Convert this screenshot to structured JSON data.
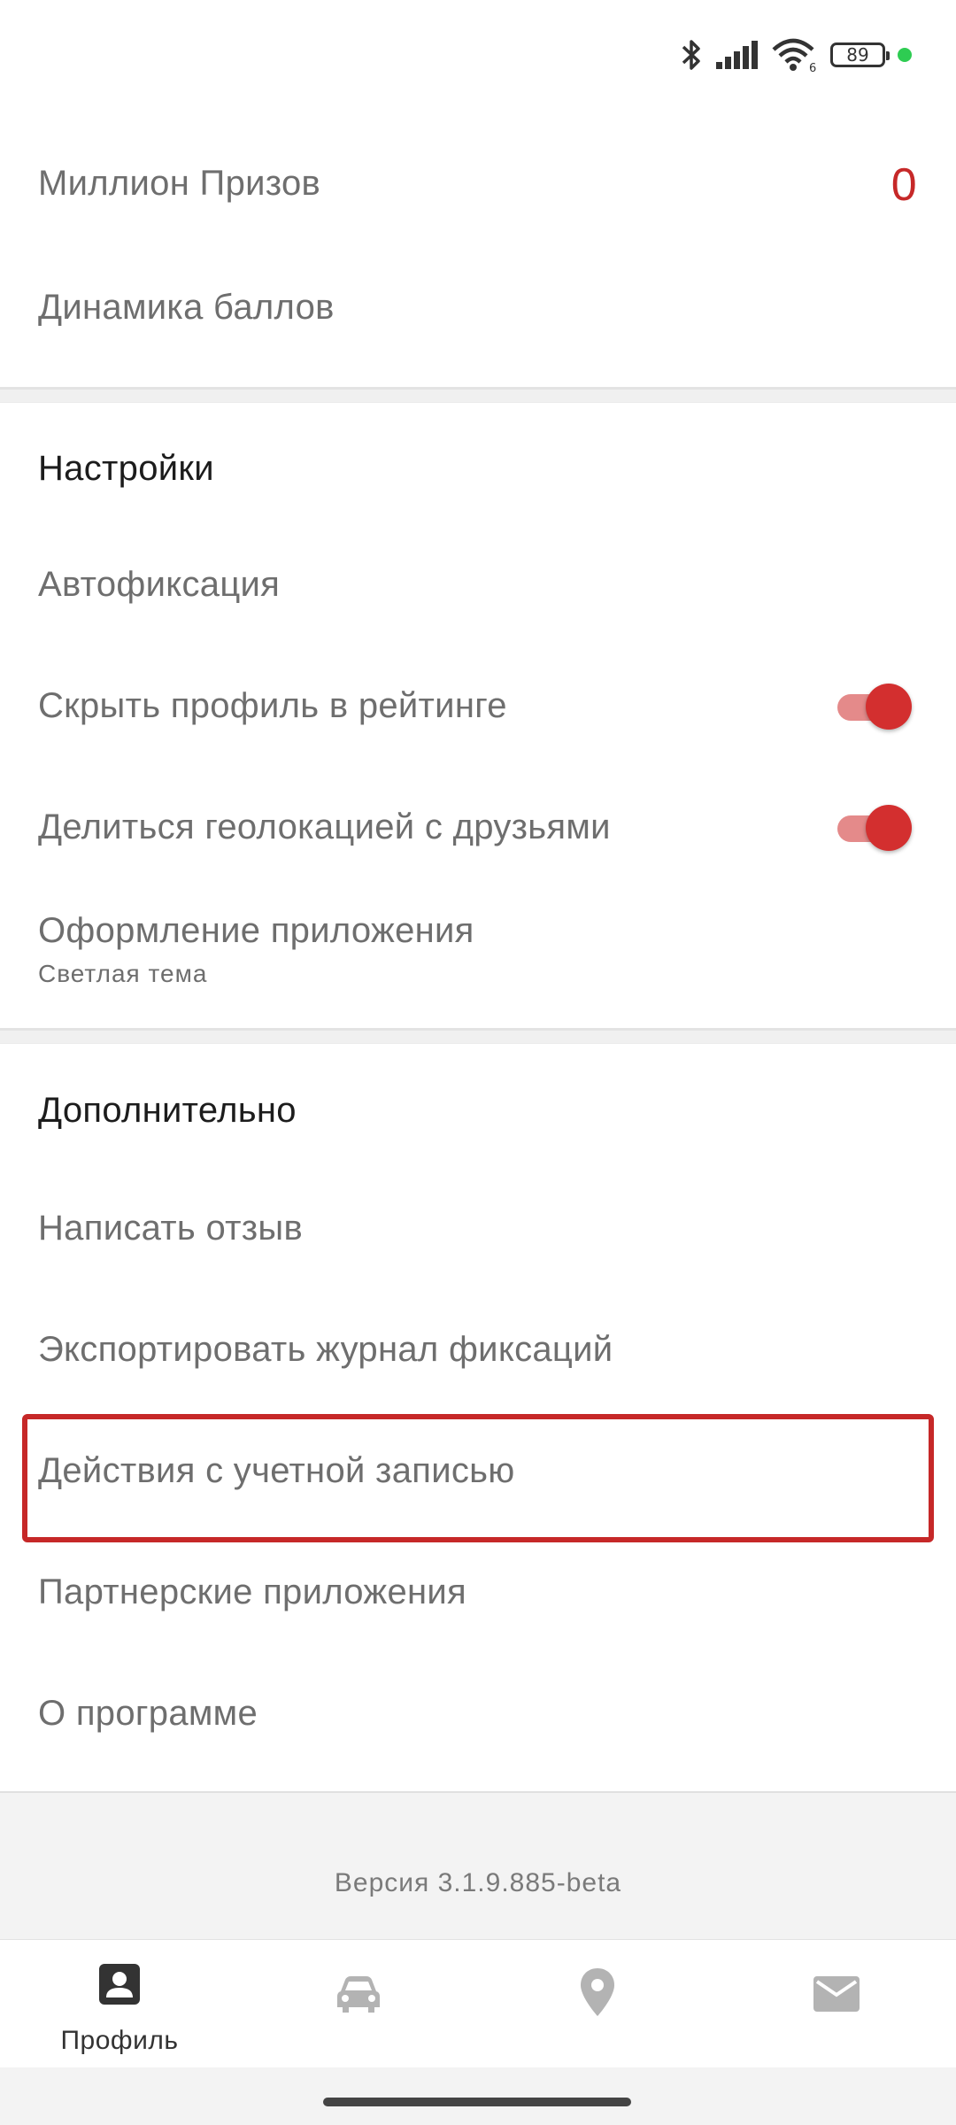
{
  "status_bar": {
    "battery_level": "89",
    "icons": [
      "bluetooth-icon",
      "signal-icon",
      "wifi-icon",
      "battery-icon",
      "status-dot"
    ],
    "wifi_badge": "6"
  },
  "profile": {
    "million_prizes_label": "Миллион Призов",
    "million_prizes_count": "0",
    "points_dynamics_label": "Динамика баллов"
  },
  "settings": {
    "title": "Настройки",
    "autofix_label": "Автофиксация",
    "hide_profile_label": "Скрыть профиль в рейтинге",
    "hide_profile_enabled": true,
    "share_geo_label": "Делиться геолокацией с друзьями",
    "share_geo_enabled": true,
    "theme_label": "Оформление приложения",
    "theme_value": "Светлая тема"
  },
  "additional": {
    "title": "Дополнительно",
    "write_review_label": "Написать отзыв",
    "export_log_label": "Экспортировать журнал фиксаций",
    "account_actions_label": "Действия с учетной записью",
    "partner_apps_label": "Партнерские приложения",
    "about_label": "О программе"
  },
  "footer": {
    "version": "Версия 3.1.9.885-beta"
  },
  "bottom_nav": {
    "items": [
      {
        "label": "Профиль",
        "icon": "profile-icon",
        "active": true
      },
      {
        "label": "",
        "icon": "car-icon",
        "active": false
      },
      {
        "label": "",
        "icon": "location-pin-icon",
        "active": false
      },
      {
        "label": "",
        "icon": "mail-icon",
        "active": false
      }
    ]
  },
  "colors": {
    "accent": "#c62828",
    "toggle_track": "#e48a8a",
    "text_secondary": "#6e6e6e",
    "text_primary": "#1c1c1c"
  }
}
